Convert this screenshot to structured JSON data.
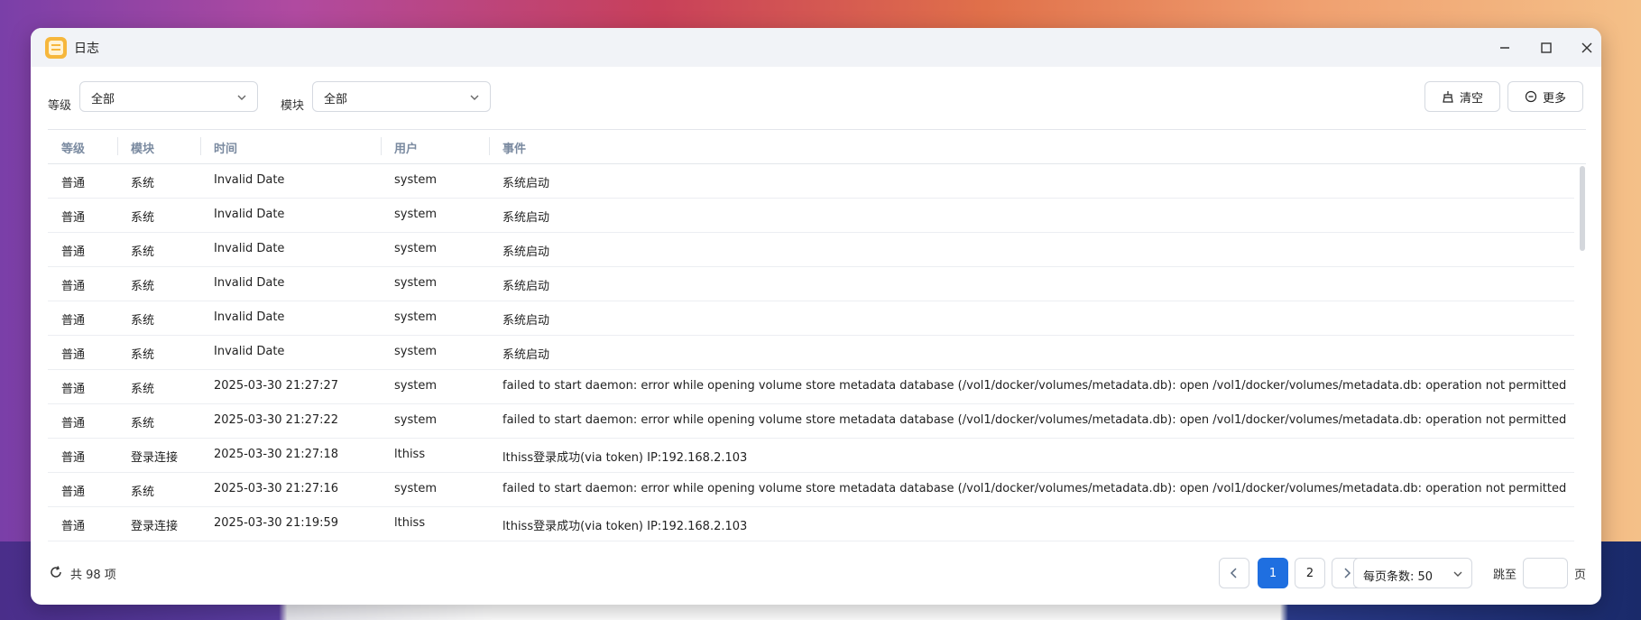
{
  "window": {
    "title": "日志"
  },
  "toolbar": {
    "level_label": "等级",
    "level_value": "全部",
    "module_label": "模块",
    "module_value": "全部",
    "clear_label": "清空",
    "more_label": "更多"
  },
  "table": {
    "headers": [
      "等级",
      "模块",
      "时间",
      "用户",
      "事件"
    ],
    "rows": [
      {
        "level": "普通",
        "module": "系统",
        "time": "Invalid Date",
        "user": "system",
        "event": "系统启动"
      },
      {
        "level": "普通",
        "module": "系统",
        "time": "Invalid Date",
        "user": "system",
        "event": "系统启动"
      },
      {
        "level": "普通",
        "module": "系统",
        "time": "Invalid Date",
        "user": "system",
        "event": "系统启动"
      },
      {
        "level": "普通",
        "module": "系统",
        "time": "Invalid Date",
        "user": "system",
        "event": "系统启动"
      },
      {
        "level": "普通",
        "module": "系统",
        "time": "Invalid Date",
        "user": "system",
        "event": "系统启动"
      },
      {
        "level": "普通",
        "module": "系统",
        "time": "Invalid Date",
        "user": "system",
        "event": "系统启动"
      },
      {
        "level": "普通",
        "module": "系统",
        "time": "2025-03-30 21:27:27",
        "user": "system",
        "event": "failed to start daemon: error while opening volume store metadata database (/vol1/docker/volumes/metadata.db): open /vol1/docker/volumes/metadata.db: operation not permitted"
      },
      {
        "level": "普通",
        "module": "系统",
        "time": "2025-03-30 21:27:22",
        "user": "system",
        "event": "failed to start daemon: error while opening volume store metadata database (/vol1/docker/volumes/metadata.db): open /vol1/docker/volumes/metadata.db: operation not permitted"
      },
      {
        "level": "普通",
        "module": "登录连接",
        "time": "2025-03-30 21:27:18",
        "user": "lthiss",
        "event": "lthiss登录成功(via token) IP:192.168.2.103"
      },
      {
        "level": "普通",
        "module": "系统",
        "time": "2025-03-30 21:27:16",
        "user": "system",
        "event": "failed to start daemon: error while opening volume store metadata database (/vol1/docker/volumes/metadata.db): open /vol1/docker/volumes/metadata.db: operation not permitted"
      },
      {
        "level": "普通",
        "module": "登录连接",
        "time": "2025-03-30 21:19:59",
        "user": "lthiss",
        "event": "lthiss登录成功(via token) IP:192.168.2.103"
      }
    ]
  },
  "footer": {
    "total": "共 98 项",
    "pages": [
      "1",
      "2"
    ],
    "page_size": "每页条数: 50",
    "jump_label": "跳至",
    "page_label": "页"
  },
  "icons": {
    "app": "log-app-icon",
    "minimize": "minimize-icon",
    "maximize": "maximize-icon",
    "close": "close-icon",
    "clear": "broom-icon",
    "more": "more-circle-icon",
    "refresh": "refresh-icon"
  },
  "colors": {
    "accent": "#1f6fe0",
    "header_text": "#7a8aa0",
    "app_icon": "#f6b73c"
  }
}
